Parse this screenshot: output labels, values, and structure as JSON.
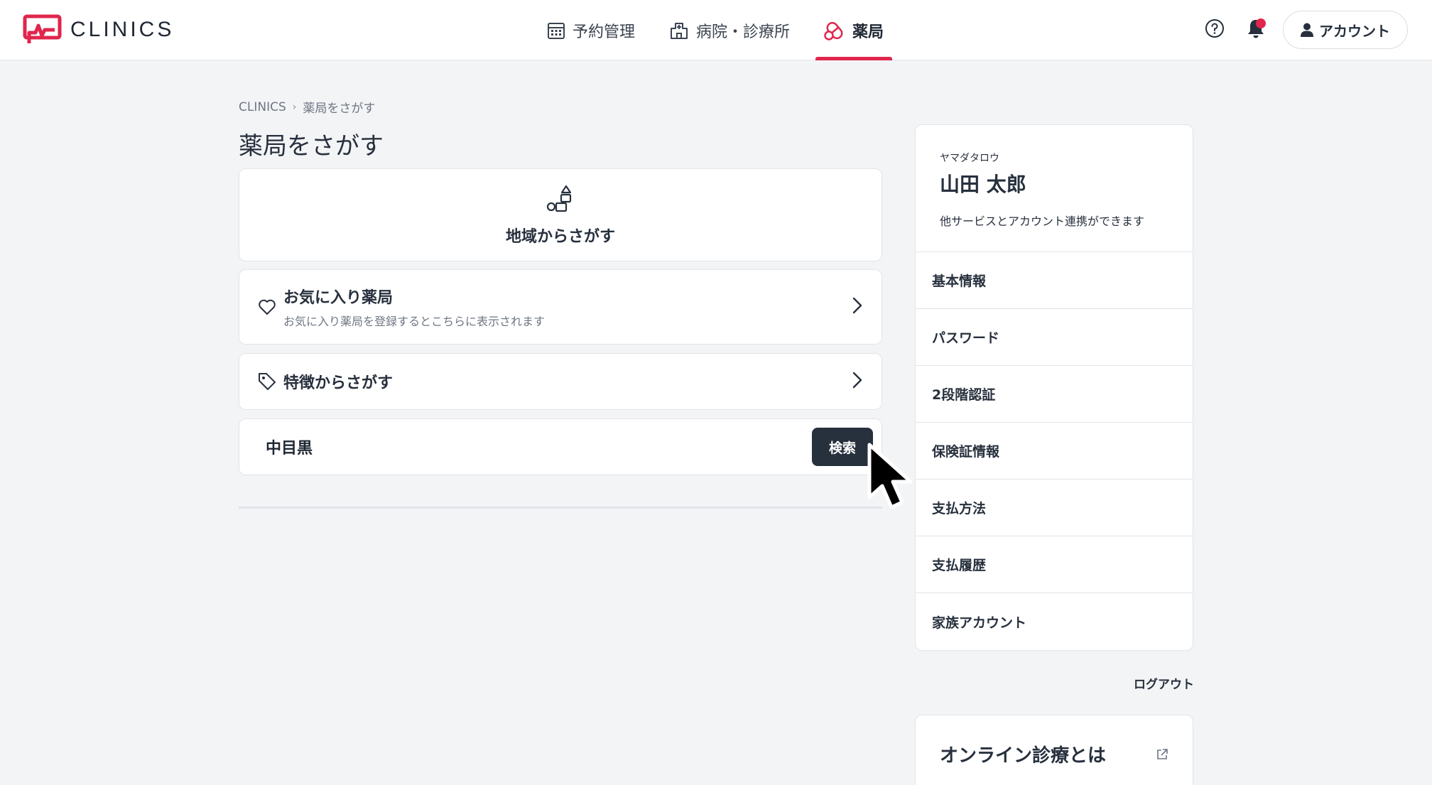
{
  "header": {
    "logo_text": "CLINICS",
    "brand_color": "#e0264d",
    "nav": [
      {
        "label": "予約管理",
        "icon": "calendar-icon"
      },
      {
        "label": "病院・診療所",
        "icon": "hospital-icon"
      },
      {
        "label": "薬局",
        "icon": "pill-icon",
        "active": true
      }
    ],
    "help_icon": "question-circle-icon",
    "notification_icon": "bell-icon",
    "account_label": "アカウント"
  },
  "breadcrumb": [
    "CLINICS",
    "薬局をさがす"
  ],
  "page_title": "薬局をさがす",
  "region_search": {
    "label": "地域からさがす",
    "icon": "map-blocks-icon"
  },
  "favorites": {
    "title": "お気に入り薬局",
    "subtitle": "お気に入り薬局を登録するとこちらに表示されます",
    "icon": "heart-icon"
  },
  "features": {
    "title": "特徴からさがす",
    "icon": "tag-icon"
  },
  "search": {
    "value": "中目黒",
    "button_label": "検索"
  },
  "profile": {
    "kana": "ヤマダタロウ",
    "name": "山田 太郎",
    "link_info": "他サービスとアカウント連携ができます"
  },
  "menu": [
    "基本情報",
    "パスワード",
    "2段階認証",
    "保険証情報",
    "支払方法",
    "支払履歴",
    "家族アカウント"
  ],
  "logout_label": "ログアウト",
  "online_card": {
    "title": "オンライン診療とは",
    "icon": "external-link-icon"
  }
}
